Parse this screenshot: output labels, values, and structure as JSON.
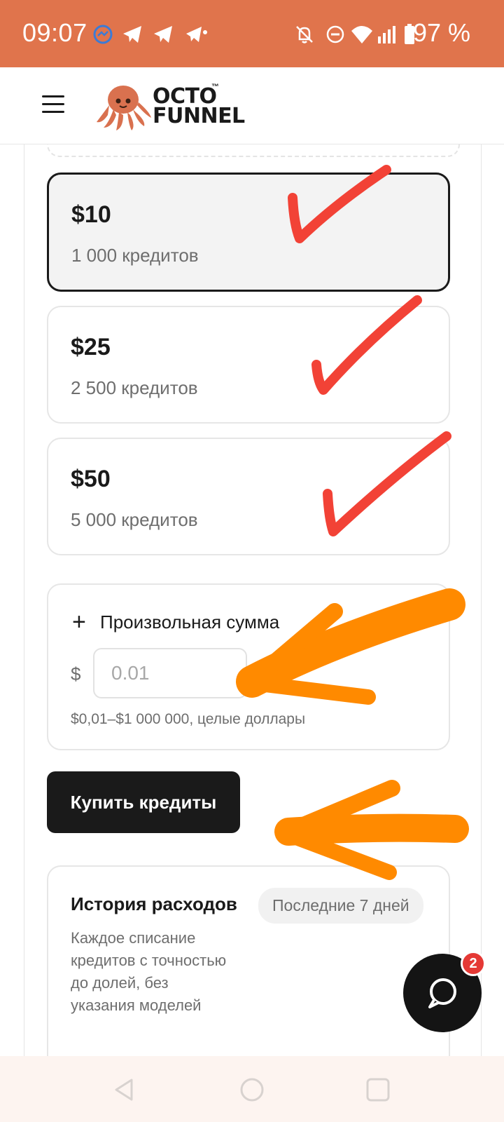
{
  "status_bar": {
    "time": "09:07",
    "battery": "97 %",
    "left_icons": [
      "messenger-icon",
      "telegram-icon",
      "telegram-icon",
      "telegram-icon"
    ],
    "right_icons": [
      "bell-off-icon",
      "do-not-disturb-icon",
      "wifi-icon",
      "signal-icon",
      "battery-icon"
    ],
    "background": "#e0744c"
  },
  "header": {
    "logo_line1": "OCTO",
    "logo_line2": "FUNNEL",
    "logo_tm": "™",
    "logo_color": "#d9714f"
  },
  "plans": [
    {
      "price": "$10",
      "credits": "1 000 кредитов",
      "selected": true
    },
    {
      "price": "$25",
      "credits": "2 500 кредитов",
      "selected": false
    },
    {
      "price": "$50",
      "credits": "5 000 кредитов",
      "selected": false
    }
  ],
  "custom_amount": {
    "title": "Произвольная сумма",
    "currency": "$",
    "placeholder": "0.01",
    "hint": "$0,01–$1 000 000, целые доллары"
  },
  "buy_button": {
    "label": "Купить кредиты"
  },
  "history": {
    "title": "История расходов",
    "period": "Последние 7 дней",
    "description": "Каждое списание кредитов с точностью до долей, без указания моделей"
  },
  "chat": {
    "badge": "2"
  },
  "colors": {
    "annotation_check": "#f24236",
    "annotation_arrow": "#ff8a00",
    "primary": "#1a1a1a"
  }
}
